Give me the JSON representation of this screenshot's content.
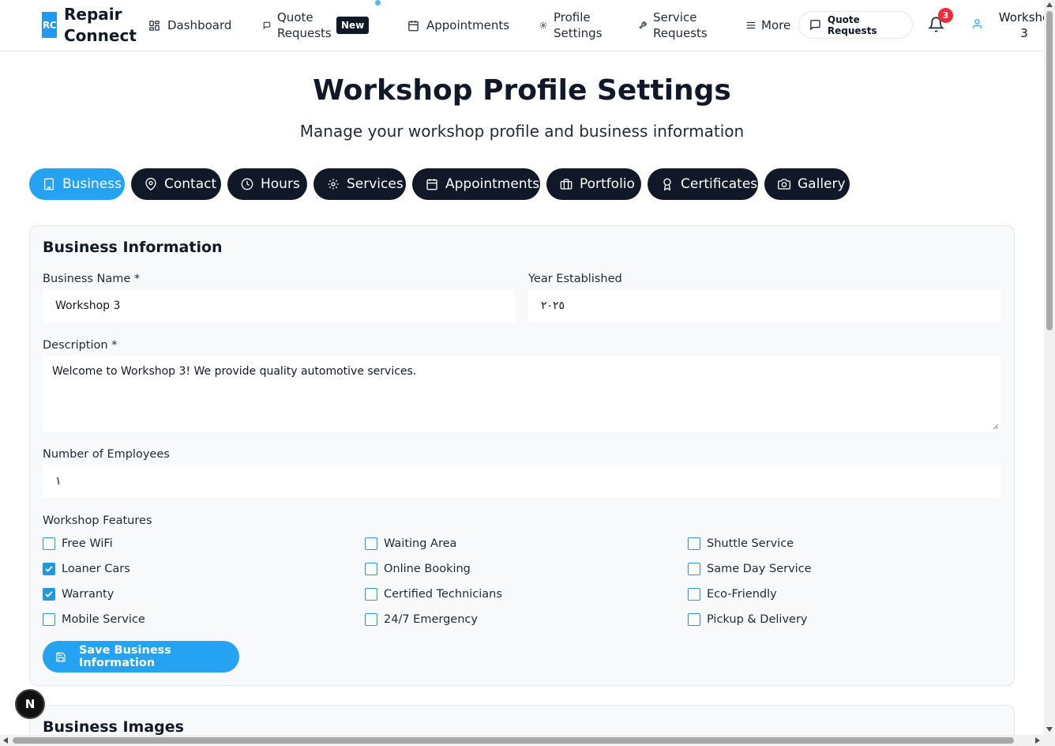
{
  "brand": {
    "logo": "RC",
    "name_line1": "Repair",
    "name_line2": "Connect"
  },
  "nav": {
    "dashboard": "Dashboard",
    "quote_line1": "Quote",
    "quote_line2": "Requests",
    "new_badge": "New",
    "appointments": "Appointments",
    "profile_line1": "Profile",
    "profile_line2": "Settings",
    "service_line1": "Service",
    "service_line2": "Requests",
    "more": "More",
    "quote_button": "Quote Requests",
    "notification_count": "3",
    "user_line1": "Worksho",
    "user_line2": "3"
  },
  "header": {
    "title": "Workshop Profile Settings",
    "subtitle": "Manage your workshop profile and business information"
  },
  "tabs": [
    {
      "label": "Business",
      "icon": "building-icon",
      "active": true
    },
    {
      "label": "Contact",
      "icon": "map-pin-icon",
      "active": false
    },
    {
      "label": "Hours",
      "icon": "clock-icon",
      "active": false
    },
    {
      "label": "Services",
      "icon": "gear-icon",
      "active": false
    },
    {
      "label": "Appointments",
      "icon": "calendar-icon",
      "active": false
    },
    {
      "label": "Portfolio",
      "icon": "briefcase-icon",
      "active": false
    },
    {
      "label": "Certificates",
      "icon": "award-icon",
      "active": false
    },
    {
      "label": "Gallery",
      "icon": "camera-icon",
      "active": false
    }
  ],
  "business": {
    "section_title": "Business Information",
    "name_label": "Business Name *",
    "name_value": "Workshop 3",
    "year_label": "Year Established",
    "year_value": "٢٠٢٥",
    "description_label": "Description *",
    "description_value": "Welcome to Workshop 3! We provide quality automotive services.",
    "employees_label": "Number of Employees",
    "employees_value": "١",
    "features_label": "Workshop Features",
    "features": [
      {
        "label": "Free WiFi",
        "checked": false
      },
      {
        "label": "Waiting Area",
        "checked": false
      },
      {
        "label": "Shuttle Service",
        "checked": false
      },
      {
        "label": "Loaner Cars",
        "checked": true
      },
      {
        "label": "Online Booking",
        "checked": false
      },
      {
        "label": "Same Day Service",
        "checked": false
      },
      {
        "label": "Warranty",
        "checked": true
      },
      {
        "label": "Certified Technicians",
        "checked": false
      },
      {
        "label": "Eco-Friendly",
        "checked": false
      },
      {
        "label": "Mobile Service",
        "checked": false
      },
      {
        "label": "24/7 Emergency",
        "checked": false
      },
      {
        "label": "Pickup & Delivery",
        "checked": false
      }
    ],
    "save_label": "Save Business Information"
  },
  "images_section": {
    "title": "Business Images"
  },
  "dev_badge": "N",
  "colors": {
    "accent": "#25a2f1",
    "dark": "#111827",
    "badge_red": "#ef2b3a"
  }
}
